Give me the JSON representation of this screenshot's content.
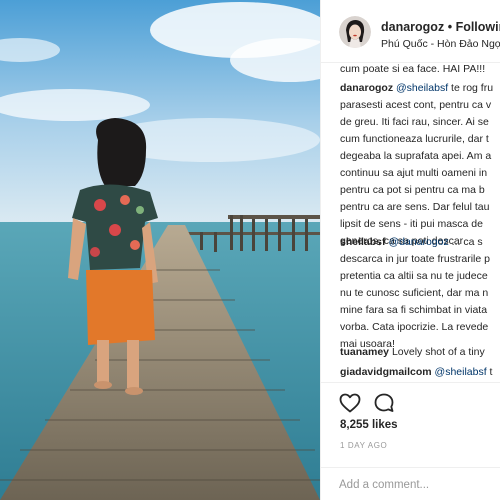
{
  "post": {
    "username": "danarogoz",
    "separator": "•",
    "follow_status": "Following",
    "location": "Phú Quốc - Hòn Đảo Ngọc"
  },
  "comments": [
    {
      "lines": [
        {
          "text": "cum poate si ea face. HAI PA!!!"
        }
      ]
    },
    {
      "user": "danarogoz",
      "mention": "@sheilabsf",
      "first_line_rest": " te rog fru",
      "lines": [
        {
          "text": "parasesti acest cont, pentru ca v"
        },
        {
          "text": "de greu. Iti faci rau, sincer. Ai se"
        },
        {
          "text": "cum functioneaza lucrurile, dar t"
        },
        {
          "text": "degeaba la suprafata apei. Am a"
        },
        {
          "text": "continuu sa ajut multi oameni in"
        },
        {
          "text": "pentru ca pot si pentru ca ma b"
        },
        {
          "text": "pentru ca are sens. Dar felul tau"
        },
        {
          "text": "lipsit de sens - iti pui masca de"
        },
        {
          "text": "generos, ca sa poti descar"
        }
      ]
    },
    {
      "user": "sheilabsf",
      "mention": "@danarogoz",
      "first_line_rest": " ... ca s",
      "lines": [
        {
          "text": "descarca in jur toate frustrarile p"
        },
        {
          "text": "pretentia ca altii sa nu te judece"
        },
        {
          "text": "nu te cunosc suficient, dar ma n"
        },
        {
          "text": "mine fara sa fi schimbat in viata"
        },
        {
          "text": "vorba. Cata ipocrizie. La revede"
        },
        {
          "text": "mai usoara!"
        }
      ]
    },
    {
      "user": "tuanamey",
      "first_line_rest": " Lovely shot of a tiny"
    },
    {
      "user": "giadavidgmailcom",
      "mention": "@sheilabsf",
      "first_line_rest": " t"
    }
  ],
  "actions": {
    "like_icon": "heart-icon",
    "comment_icon": "speech-bubble-icon",
    "likes": "8,255 likes",
    "time": "1 DAY AGO",
    "comment_placeholder": "Add a comment..."
  },
  "colors": {
    "text": "#262626",
    "mention": "#003569",
    "muted": "#999999",
    "border": "#efefef",
    "sky": "#5fa8d6",
    "sea": "#3f8fa8"
  }
}
